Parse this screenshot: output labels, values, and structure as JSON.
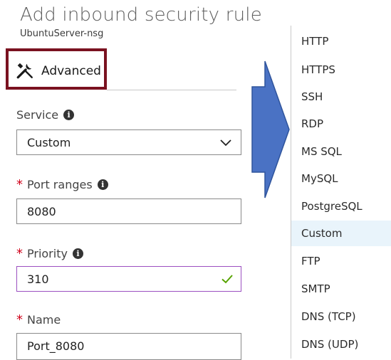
{
  "panel": {
    "title": "Add inbound security rule",
    "subtitle": "UbuntuServer-nsg",
    "advanced_label": "Advanced"
  },
  "form": {
    "service": {
      "label": "Service",
      "value": "Custom"
    },
    "port_ranges": {
      "required_mark": "*",
      "label": "Port ranges",
      "value": "8080"
    },
    "priority": {
      "required_mark": "*",
      "label": "Priority",
      "value": "310"
    },
    "name": {
      "required_mark": "*",
      "label": "Name",
      "value": "Port_8080"
    }
  },
  "service_options": [
    "HTTP",
    "HTTPS",
    "SSH",
    "RDP",
    "MS SQL",
    "MySQL",
    "PostgreSQL",
    "Custom",
    "FTP",
    "SMTP",
    "DNS (TCP)",
    "DNS (UDP)"
  ],
  "selected_service": "Custom",
  "colors": {
    "highlight_box": "#7a1220",
    "arrow_fill": "#4a72c4",
    "arrow_stroke": "#2f549c",
    "required_star": "#d0021b",
    "valid_check": "#57a300",
    "valid_border": "#9b4fc0",
    "selected_bg": "#e9f4fb"
  },
  "icons": {
    "advanced": "tools-icon",
    "info": "info-icon",
    "dropdown": "chevron-down-icon",
    "valid": "checkmark-icon"
  }
}
